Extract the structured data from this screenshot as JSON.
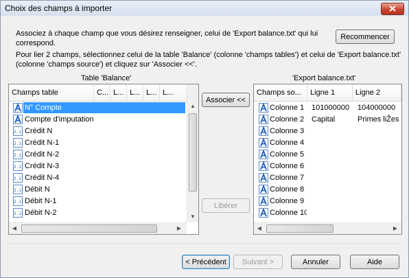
{
  "window": {
    "title": "Choix des champs à importer"
  },
  "instructions": {
    "line1": "Associez à chaque champ que vous désirez renseigner, celui de 'Export balance.txt' qui lui",
    "line2": "correspond.",
    "line3": "Pour lier 2 champs, sélectionnez celui de la table 'Balance' (colonne 'champs tables') et celui de 'Export balance.txt'",
    "line4": "(colonne 'champs source') et cliquez sur 'Associer <<'."
  },
  "buttons": {
    "restart": "Recommencer",
    "associate": "Associer <<",
    "unlink": "Libérer",
    "previous": "< Précédent",
    "next": "Suivant >",
    "cancel": "Annuler",
    "help": "Aide"
  },
  "left_table": {
    "caption": "Table 'Balance'",
    "columns": [
      "Champs table",
      "C...",
      "L...",
      "L...",
      "L...",
      "L..."
    ],
    "rows": [
      {
        "label": "N° Compte",
        "icon": "text-field-icon",
        "selected": true
      },
      {
        "label": "Compte d'imputation",
        "icon": "text-field-icon",
        "selected": false
      },
      {
        "label": "Crédit N",
        "icon": "numeric-field-icon",
        "selected": false
      },
      {
        "label": "Crédit N-1",
        "icon": "numeric-field-icon",
        "selected": false
      },
      {
        "label": "Crédit N-2",
        "icon": "numeric-field-icon",
        "selected": false
      },
      {
        "label": "Crédit N-3",
        "icon": "numeric-field-icon",
        "selected": false
      },
      {
        "label": "Crédit N-4",
        "icon": "numeric-field-icon",
        "selected": false
      },
      {
        "label": "Débit N",
        "icon": "numeric-field-icon",
        "selected": false
      },
      {
        "label": "Débit N-1",
        "icon": "numeric-field-icon",
        "selected": false
      },
      {
        "label": "Débit N-2",
        "icon": "numeric-field-icon",
        "selected": false
      }
    ]
  },
  "right_table": {
    "caption": "'Export balance.txt'",
    "columns": [
      "Champs so...",
      "Ligne 1",
      "Ligne 2"
    ],
    "rows": [
      {
        "label": "Colonne 1",
        "ligne1": "101000000",
        "ligne2": "104000000"
      },
      {
        "label": "Colonne 2",
        "ligne1": "Capital",
        "ligne2": "Primes liŽes"
      },
      {
        "label": "Colonne 3",
        "ligne1": "",
        "ligne2": ""
      },
      {
        "label": "Colonne 4",
        "ligne1": "",
        "ligne2": ""
      },
      {
        "label": "Colonne 5",
        "ligne1": "",
        "ligne2": ""
      },
      {
        "label": "Colonne 6",
        "ligne1": "",
        "ligne2": ""
      },
      {
        "label": "Colonne 7",
        "ligne1": "",
        "ligne2": ""
      },
      {
        "label": "Colonne 8",
        "ligne1": "",
        "ligne2": ""
      },
      {
        "label": "Colonne 9",
        "ligne1": "",
        "ligne2": ""
      },
      {
        "label": "Colonne 10",
        "ligne1": "",
        "ligne2": ""
      }
    ]
  },
  "colors": {
    "selection": "#3399ff",
    "icon_blue": "#1f5fbf"
  }
}
